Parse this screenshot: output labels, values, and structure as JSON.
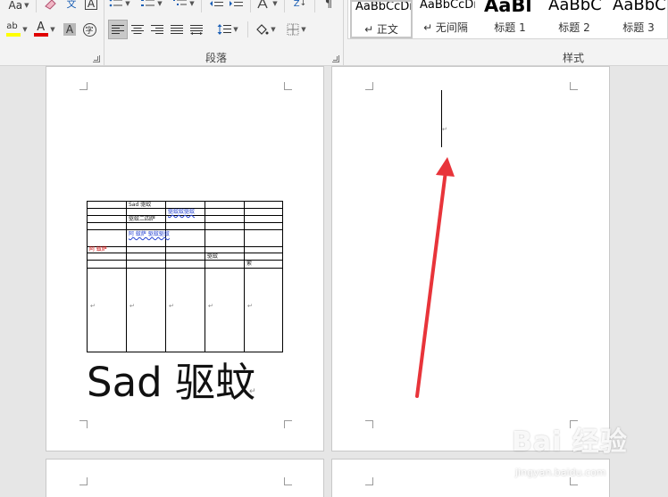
{
  "ribbon": {
    "font_size_label": "Aa",
    "clear_format_label": "",
    "phonetic_label": "文",
    "char_border_label": "A",
    "highlight_label": "ab",
    "font_color_label": "A",
    "char_shading_label": "A",
    "enclose_char_label": "字",
    "sort_label": "Z",
    "paragraph_group_label": "段落",
    "styles_group_label": "样式",
    "colors": {
      "highlight": "#ffff00",
      "font_color": "#e00000"
    }
  },
  "styles": [
    {
      "sample": "AaBbCcDı",
      "name": "↵ 正文"
    },
    {
      "sample": "AaBbCcDı",
      "name": "↵ 无间隔"
    },
    {
      "sample": "AaBl",
      "name": "标题 1"
    },
    {
      "sample": "AaBbC",
      "name": "标题 2"
    },
    {
      "sample": "AaBbC",
      "name": "标题 3"
    }
  ],
  "document": {
    "table": {
      "cells": [
        {
          "text": "Sad 驱蚊"
        },
        {
          "text": "驱蚊蚊驱蚊"
        },
        {
          "text": "驱蚊二四萨"
        },
        {
          "text": "阿 蚊萨 驱蚊驱蚊"
        },
        {
          "text": "阿 蚊萨"
        },
        {
          "text": "驱蚊"
        },
        {
          "text": "萦"
        }
      ],
      "para_mark": "↵"
    },
    "big_text": "Sad 驱蚊",
    "big_text_mark": "↵",
    "cursor_mark": "↵"
  },
  "watermark": {
    "main": "Bai 经验",
    "sub": "jingyan.baidu.com"
  }
}
